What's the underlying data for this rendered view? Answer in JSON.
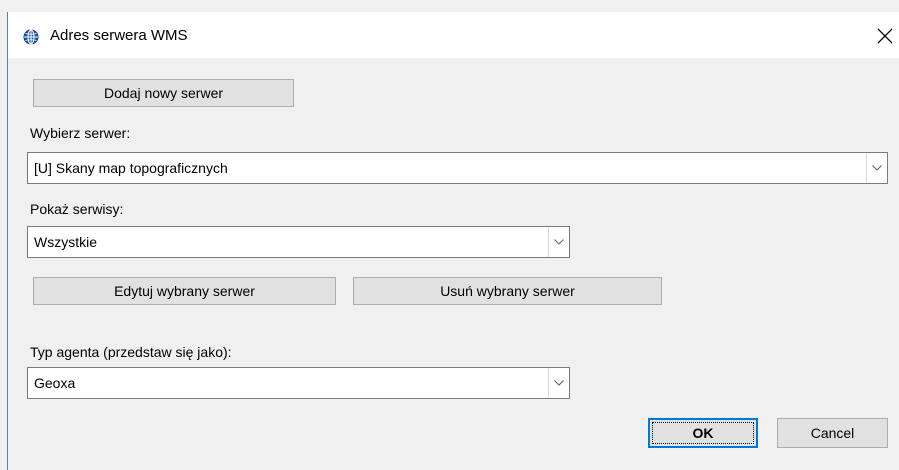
{
  "window": {
    "title": "Adres serwera WMS",
    "icon": "globe-icon",
    "close_icon": "close-icon"
  },
  "buttons": {
    "add_server": "Dodaj nowy serwer",
    "edit_server": "Edytuj wybrany serwer",
    "delete_server": "Usuń wybrany serwer",
    "ok": "OK",
    "cancel": "Cancel"
  },
  "server_select": {
    "label": "Wybierz serwer:",
    "value": "[U] Skany map topograficznych"
  },
  "services_select": {
    "label": "Pokaż serwisy:",
    "value": "Wszystkie"
  },
  "agent_select": {
    "label": "Typ agenta (przedstaw się jako):",
    "value": "Geoxa"
  },
  "colors": {
    "accent": "#0078d7",
    "globe": "#1e5aa8",
    "dialog_bg": "#f0f0f0",
    "button_bg": "#e1e1e1"
  }
}
